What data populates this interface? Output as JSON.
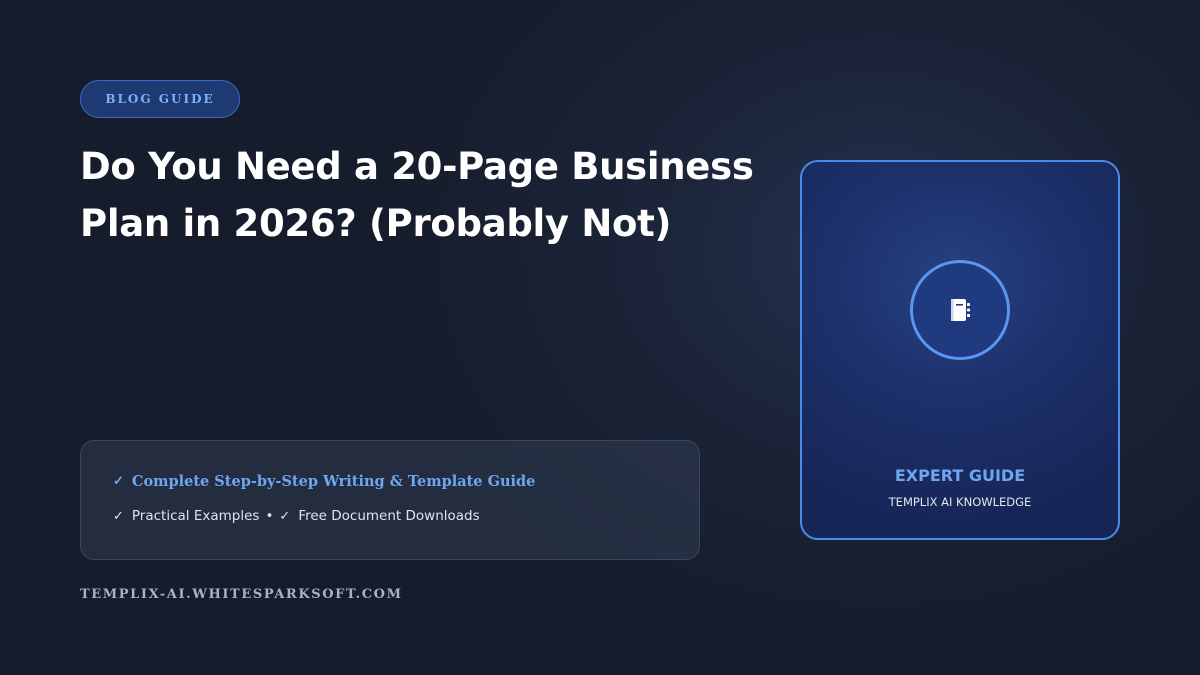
{
  "badge": {
    "label": "BLOG GUIDE"
  },
  "article": {
    "title_line1": "Do You Need a 20-Page Business",
    "title_line2": "Plan in 2026? (Probably Not)"
  },
  "features": {
    "check_glyph": "✓",
    "line1": "Complete Step-by-Step Writing & Template Guide",
    "item_a": "Practical Examples",
    "separator": "•",
    "item_b": "Free Document Downloads"
  },
  "footer": {
    "domain": "TEMPLIX-AI.WHITESPARKSOFT.COM"
  },
  "card": {
    "icon": "notebook-icon",
    "label": "EXPERT GUIDE",
    "sub": "TEMPLIX AI KNOWLEDGE"
  },
  "colors": {
    "accent": "#6ea6f2",
    "card_border": "#4a8ae8",
    "badge_bg": "#1e3a72",
    "background": "#1b2438"
  }
}
